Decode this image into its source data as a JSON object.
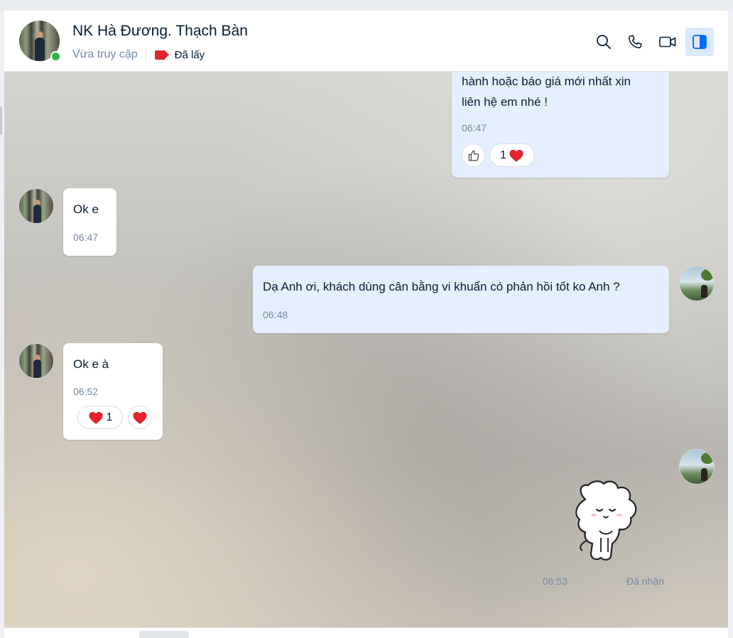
{
  "header": {
    "contact_name": "NK Hà Đương. Thạch Bàn",
    "last_seen": "Vừa truy cập",
    "tag_label": "Đã lấy",
    "tag_color": "#e0262b",
    "online_color": "#31b54a",
    "actions": [
      {
        "icon": "search-icon",
        "name": "search-button"
      },
      {
        "icon": "phone-icon",
        "name": "call-button"
      },
      {
        "icon": "video-icon",
        "name": "video-call-button"
      },
      {
        "icon": "sidebar-toggle-icon",
        "name": "toggle-info-panel-button",
        "active": true
      }
    ]
  },
  "messages": [
    {
      "sender": "me",
      "lines": [
        "hành hoặc báo giá mới nhất xin",
        "liên hệ em nhé !"
      ],
      "time": "06:47",
      "reactions": [
        {
          "icon": "thumbs-up-icon"
        },
        {
          "count": "1",
          "icon": "heart-icon"
        }
      ]
    },
    {
      "sender": "contact",
      "lines": [
        "Ok e"
      ],
      "time": "06:47"
    },
    {
      "sender": "me",
      "lines": [
        "Dạ Anh ơi, khách dùng cân bằng vi khuẩn có phản hồi tốt ko Anh ?"
      ],
      "time": "06:48"
    },
    {
      "sender": "contact",
      "lines": [
        "Ok e à"
      ],
      "time": "06:52",
      "reactions": [
        {
          "icon": "heart-icon",
          "count": "1"
        },
        {
          "icon": "heart-icon"
        }
      ]
    },
    {
      "sender": "me",
      "sticker": "bunny-sticker",
      "time": "06:53",
      "status": "Đã nhận"
    }
  ],
  "colors": {
    "my_bubble": "#e5efff",
    "their_bubble": "#ffffff",
    "accent": "#0068ff",
    "heart": "#e8232e"
  }
}
